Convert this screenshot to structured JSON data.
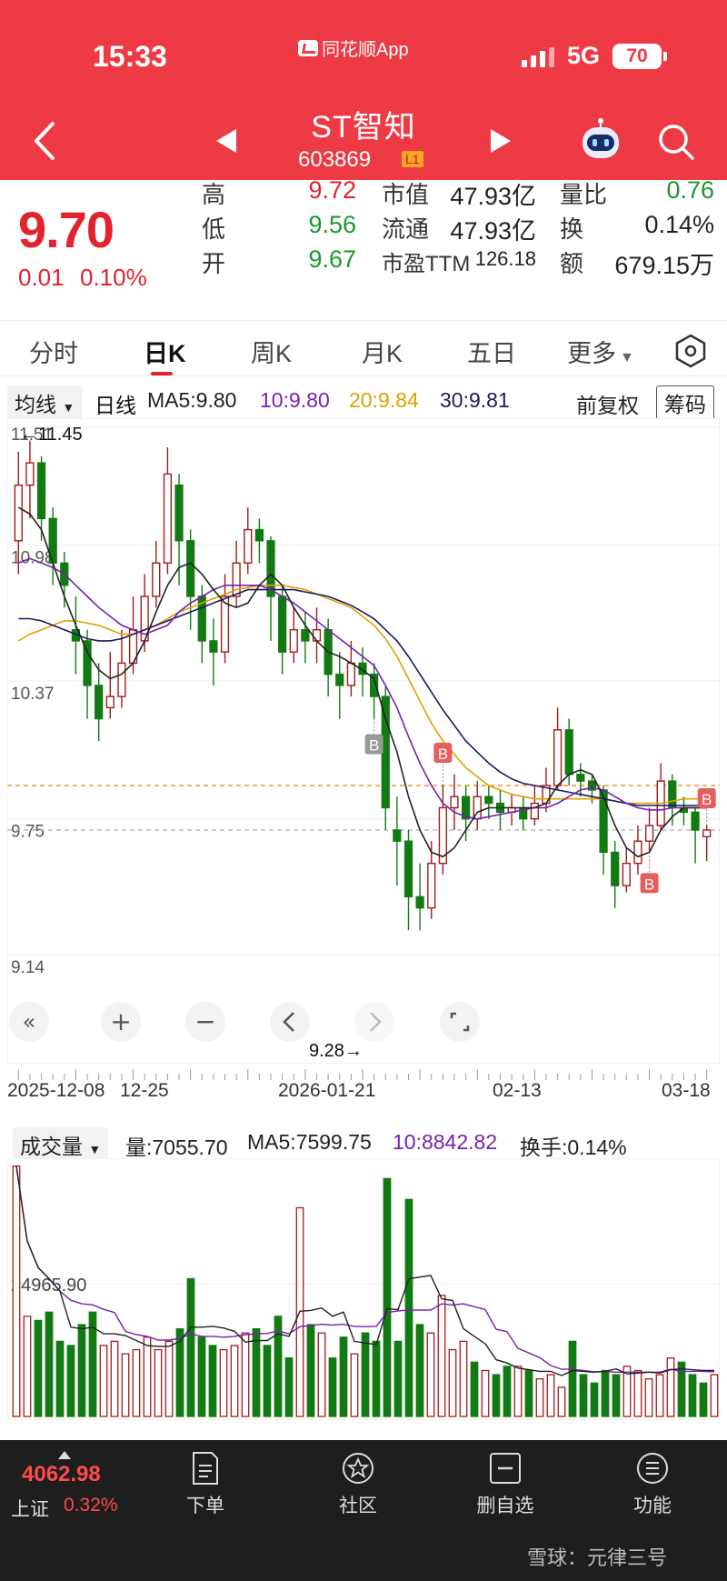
{
  "status_bar": {
    "time": "15:33",
    "app_name": "同花顺App",
    "network": "5G",
    "battery": "70"
  },
  "header": {
    "stock_name": "ST智知",
    "stock_code": "603869",
    "level_badge": "L1"
  },
  "quote": {
    "price": "9.70",
    "change": "0.01",
    "change_pct": "0.10%",
    "fields": [
      {
        "label": "高",
        "value": "9.72",
        "color": "red"
      },
      {
        "label": "低",
        "value": "9.56",
        "color": "green"
      },
      {
        "label": "开",
        "value": "9.67",
        "color": "green"
      },
      {
        "label": "市值",
        "value": "47.93亿",
        "color": "dark"
      },
      {
        "label": "流通",
        "value": "47.93亿",
        "color": "dark"
      },
      {
        "label": "市盈TTM",
        "value": "126.18",
        "color": "dark"
      },
      {
        "label": "量比",
        "value": "0.76",
        "color": "green"
      },
      {
        "label": "换",
        "value": "0.14%",
        "color": "dark"
      },
      {
        "label": "额",
        "value": "679.15万",
        "color": "dark"
      }
    ]
  },
  "tabs": [
    "分时",
    "日K",
    "周K",
    "月K",
    "五日",
    "更多"
  ],
  "active_tab": "日K",
  "ma": {
    "selector": "均线",
    "period": "日线",
    "ma5": "MA5:9.80",
    "ma10": "10:9.80",
    "ma20": "20:9.84",
    "ma30": "30:9.81",
    "adjust": "前复权",
    "chip_button": "筹码"
  },
  "colors": {
    "up": "#a31b1b",
    "down": "#127a12",
    "ma5": "#222222",
    "ma10": "#7b1fb0",
    "ma20": "#e0a000",
    "ma30": "#1b1b5e",
    "ref_line": "#e8962c"
  },
  "chart_data": {
    "type": "candlestick",
    "y_axis_labels": [
      "11.51",
      "10.98",
      "10.37",
      "9.75",
      "9.14"
    ],
    "ylim": [
      9.14,
      11.51
    ],
    "high_marker": "11.45",
    "low_marker": "9.28",
    "date_labels": [
      "2025-12-08",
      "12-25",
      "2026-01-21",
      "02-13",
      "03-18"
    ],
    "buy_markers": [
      "B",
      "B",
      "B",
      "B"
    ],
    "ref_lines": [
      9.9,
      9.7
    ],
    "candles": [
      [
        11.0,
        11.25,
        11.4,
        10.85
      ],
      [
        11.25,
        11.35,
        11.45,
        11.1
      ],
      [
        11.35,
        11.1,
        11.38,
        11.0
      ],
      [
        11.1,
        10.9,
        11.15,
        10.8
      ],
      [
        10.9,
        10.8,
        10.95,
        10.7
      ],
      [
        10.6,
        10.55,
        10.75,
        10.4
      ],
      [
        10.55,
        10.35,
        10.6,
        10.2
      ],
      [
        10.35,
        10.2,
        10.45,
        10.1
      ],
      [
        10.25,
        10.3,
        10.5,
        10.2
      ],
      [
        10.3,
        10.45,
        10.6,
        10.25
      ],
      [
        10.45,
        10.6,
        10.75,
        10.4
      ],
      [
        10.55,
        10.75,
        10.85,
        10.5
      ],
      [
        10.75,
        10.9,
        11.0,
        10.7
      ],
      [
        10.9,
        11.3,
        11.42,
        10.85
      ],
      [
        11.25,
        11.0,
        11.3,
        10.8
      ],
      [
        11.0,
        10.75,
        11.05,
        10.6
      ],
      [
        10.75,
        10.55,
        10.8,
        10.45
      ],
      [
        10.55,
        10.5,
        10.65,
        10.35
      ],
      [
        10.5,
        10.75,
        10.85,
        10.45
      ],
      [
        10.75,
        10.9,
        11.0,
        10.7
      ],
      [
        10.9,
        11.05,
        11.15,
        10.85
      ],
      [
        11.05,
        11.0,
        11.1,
        10.9
      ],
      [
        11.0,
        10.75,
        11.02,
        10.55
      ],
      [
        10.75,
        10.5,
        10.8,
        10.4
      ],
      [
        10.5,
        10.6,
        10.7,
        10.45
      ],
      [
        10.6,
        10.55,
        10.68,
        10.45
      ],
      [
        10.55,
        10.6,
        10.7,
        10.45
      ],
      [
        10.6,
        10.4,
        10.65,
        10.3
      ],
      [
        10.4,
        10.35,
        10.5,
        10.2
      ],
      [
        10.35,
        10.45,
        10.55,
        10.3
      ],
      [
        10.45,
        10.4,
        10.52,
        10.3
      ],
      [
        10.4,
        10.3,
        10.45,
        10.2
      ],
      [
        10.3,
        9.8,
        10.35,
        9.7
      ],
      [
        9.7,
        9.65,
        9.85,
        9.45
      ],
      [
        9.65,
        9.4,
        9.7,
        9.25
      ],
      [
        9.4,
        9.35,
        9.55,
        9.25
      ],
      [
        9.35,
        9.55,
        9.65,
        9.3
      ],
      [
        9.55,
        9.8,
        9.9,
        9.5
      ],
      [
        9.8,
        9.85,
        9.95,
        9.7
      ],
      [
        9.85,
        9.75,
        9.9,
        9.65
      ],
      [
        9.75,
        9.85,
        9.92,
        9.7
      ],
      [
        9.85,
        9.82,
        9.9,
        9.75
      ],
      [
        9.82,
        9.78,
        9.88,
        9.7
      ],
      [
        9.78,
        9.8,
        9.86,
        9.72
      ],
      [
        9.8,
        9.75,
        9.85,
        9.7
      ],
      [
        9.75,
        9.82,
        9.9,
        9.72
      ],
      [
        9.82,
        9.9,
        9.98,
        9.78
      ],
      [
        9.9,
        10.15,
        10.25,
        9.88
      ],
      [
        10.15,
        9.95,
        10.2,
        9.9
      ],
      [
        9.95,
        9.92,
        10.0,
        9.85
      ],
      [
        9.92,
        9.88,
        9.95,
        9.82
      ],
      [
        9.88,
        9.6,
        9.9,
        9.5
      ],
      [
        9.6,
        9.45,
        9.65,
        9.35
      ],
      [
        9.45,
        9.55,
        9.62,
        9.42
      ],
      [
        9.55,
        9.65,
        9.72,
        9.5
      ],
      [
        9.65,
        9.72,
        9.8,
        9.6
      ],
      [
        9.72,
        9.92,
        10.0,
        9.7
      ],
      [
        9.92,
        9.8,
        9.95,
        9.72
      ],
      [
        9.8,
        9.78,
        9.85,
        9.72
      ],
      [
        9.78,
        9.7,
        9.8,
        9.55
      ],
      [
        9.67,
        9.7,
        9.72,
        9.56
      ]
    ],
    "ma5": [
      11.15,
      11.12,
      11.05,
      10.9,
      10.75,
      10.62,
      10.5,
      10.42,
      10.38,
      10.4,
      10.45,
      10.55,
      10.68,
      10.8,
      10.88,
      10.9,
      10.85,
      10.78,
      10.72,
      10.7,
      10.72,
      10.8,
      10.85,
      10.8,
      10.7,
      10.62,
      10.55,
      10.5,
      10.48,
      10.45,
      10.42,
      10.38,
      10.2,
      10.05,
      9.85,
      9.7,
      9.6,
      9.58,
      9.62,
      9.7,
      9.78,
      9.8,
      9.8,
      9.8,
      9.8,
      9.8,
      9.82,
      9.9,
      9.95,
      9.97,
      9.95,
      9.85,
      9.72,
      9.62,
      9.58,
      9.6,
      9.7,
      9.76,
      9.8,
      9.8,
      9.8
    ],
    "ma10": [
      10.9,
      10.92,
      10.9,
      10.88,
      10.85,
      10.8,
      10.75,
      10.7,
      10.66,
      10.62,
      10.6,
      10.58,
      10.6,
      10.62,
      10.68,
      10.72,
      10.75,
      10.78,
      10.8,
      10.8,
      10.8,
      10.8,
      10.78,
      10.75,
      10.72,
      10.68,
      10.64,
      10.6,
      10.56,
      10.52,
      10.48,
      10.44,
      10.35,
      10.25,
      10.12,
      10.0,
      9.9,
      9.82,
      9.78,
      9.76,
      9.75,
      9.76,
      9.77,
      9.78,
      9.79,
      9.8,
      9.8,
      9.82,
      9.85,
      9.88,
      9.89,
      9.88,
      9.85,
      9.82,
      9.8,
      9.79,
      9.79,
      9.8,
      9.8,
      9.8,
      9.8
    ],
    "ma20": [
      10.55,
      10.58,
      10.6,
      10.62,
      10.64,
      10.64,
      10.63,
      10.62,
      10.6,
      10.58,
      10.58,
      10.6,
      10.62,
      10.65,
      10.68,
      10.7,
      10.72,
      10.74,
      10.76,
      10.78,
      10.79,
      10.8,
      10.8,
      10.8,
      10.79,
      10.78,
      10.76,
      10.74,
      10.72,
      10.7,
      10.66,
      10.62,
      10.56,
      10.48,
      10.38,
      10.28,
      10.18,
      10.1,
      10.04,
      9.98,
      9.94,
      9.9,
      9.88,
      9.86,
      9.85,
      9.84,
      9.84,
      9.84,
      9.84,
      9.84,
      9.84,
      9.84,
      9.83,
      9.82,
      9.82,
      9.82,
      9.82,
      9.83,
      9.84,
      9.84,
      9.84
    ],
    "ma30": [
      10.65,
      10.65,
      10.64,
      10.62,
      10.6,
      10.58,
      10.56,
      10.55,
      10.55,
      10.56,
      10.58,
      10.6,
      10.62,
      10.64,
      10.66,
      10.68,
      10.7,
      10.72,
      10.74,
      10.76,
      10.78,
      10.78,
      10.78,
      10.78,
      10.78,
      10.77,
      10.76,
      10.75,
      10.73,
      10.71,
      10.68,
      10.65,
      10.6,
      10.55,
      10.48,
      10.4,
      10.32,
      10.24,
      10.17,
      10.1,
      10.05,
      10.0,
      9.96,
      9.93,
      9.91,
      9.9,
      9.89,
      9.88,
      9.87,
      9.86,
      9.85,
      9.84,
      9.83,
      9.82,
      9.81,
      9.81,
      9.81,
      9.81,
      9.81,
      9.81,
      9.81
    ]
  },
  "volume": {
    "selector": "成交量",
    "vol": "量:7055.70",
    "ma5": "MA5:7599.75",
    "ma10": "10:8842.82",
    "turnover": "换手:0.14%",
    "axis_label": "24965.90",
    "values": [
      30000,
      12000,
      11500,
      12500,
      9000,
      8500,
      11000,
      12500,
      8500,
      9000,
      7500,
      8000,
      9500,
      8000,
      9000,
      10500,
      16500,
      9500,
      8500,
      8000,
      8500,
      10000,
      10500,
      8500,
      12000,
      7000,
      25000,
      11000,
      10000,
      7000,
      9500,
      7500,
      10000,
      9000,
      28500,
      9000,
      26000,
      11000,
      10000,
      14500,
      8000,
      9000,
      6500,
      5500,
      5000,
      6000,
      6000,
      5500,
      4500,
      5000,
      3500,
      9000,
      5000,
      4000,
      5500,
      5000,
      6000,
      5500,
      4500,
      5000,
      7000,
      6500,
      5000,
      4000,
      5000
    ]
  },
  "date_axis_note": "",
  "bottom_nav": {
    "index_value": "4062.98",
    "index_name": "上证",
    "index_pct": "0.32%",
    "items": [
      "下单",
      "社区",
      "删自选",
      "功能"
    ],
    "watermark": "雪球：元律三号"
  }
}
